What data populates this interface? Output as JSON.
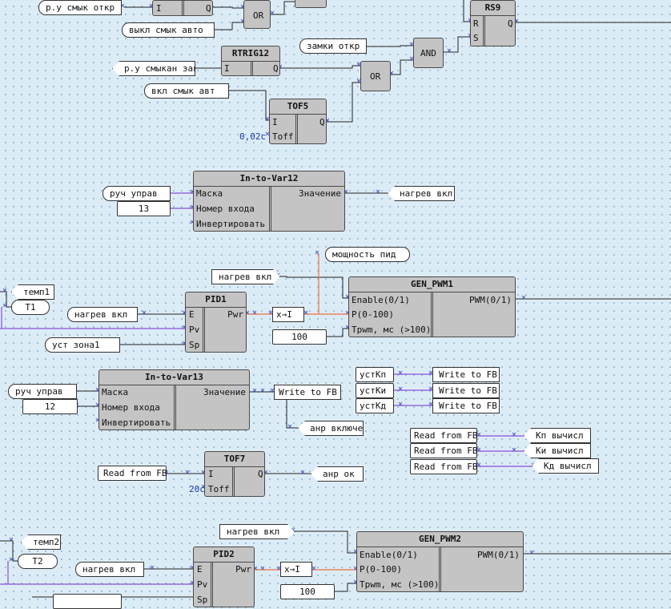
{
  "colors": {
    "wire": "#222222",
    "purple": "#8a4fd8",
    "orange": "#f07040",
    "block": "#c4c4c4"
  },
  "blocks": {
    "rs9": {
      "title": "RS9",
      "pins": [
        "R",
        "S",
        "Q"
      ]
    },
    "or_top": {
      "title": "OR"
    },
    "rtrig12": {
      "title": "RTRIG12",
      "pins": [
        "I",
        "Q"
      ]
    },
    "and": {
      "title": "AND"
    },
    "or_mid": {
      "title": "OR"
    },
    "tof5": {
      "title": "TOF5",
      "pins": [
        "I",
        "Toff",
        "Q"
      ],
      "const": "0,02c"
    },
    "in_to_var12": {
      "title": "In-to-Var12",
      "pins": [
        "Маска",
        "Номер входа",
        "Инвертировать",
        "Значение"
      ]
    },
    "gen_pwm1": {
      "title": "GEN_PWM1",
      "pins": [
        "Enable(0/1)",
        "P(0-100)",
        "Tpwm, мс (>100)",
        "PWM(0/1)"
      ]
    },
    "pid1": {
      "title": "PID1",
      "pins": [
        "E",
        "Pv",
        "Sp",
        "Pwr"
      ]
    },
    "in_to_var13": {
      "title": "In-to-Var13",
      "pins": [
        "Маска",
        "Номер входа",
        "Инвертировать",
        "Значение"
      ]
    },
    "tof7": {
      "title": "TOF7",
      "pins": [
        "I",
        "Toff",
        "Q"
      ],
      "const": "20c"
    },
    "gen_pwm2": {
      "title": "GEN_PWM2",
      "pins": [
        "Enable(0/1)",
        "P(0-100)",
        "Tpwm, мс (>100)",
        "PWM(0/1)"
      ]
    },
    "pid2": {
      "title": "PID2",
      "pins": [
        "E",
        "Pv",
        "Sp",
        "Pwr"
      ]
    },
    "top_i_q": {
      "pins": [
        "I",
        "Q"
      ]
    }
  },
  "labels": {
    "ru_smyk_otkr": "р.у смык откр",
    "vykl_smyk_avto": "выкл смык авто",
    "zamki_otkr": "замки откр",
    "ru_smykan_zakr": "р.у смыкан закр",
    "vkl_smyk_avt": "вкл смык авт",
    "ruch_uprav_1": "руч управ",
    "num_13": "13",
    "nagrev_vkl_out": "нагрев вкл",
    "moshnost_pid": "мощность пид",
    "nagrev_vkl_2": "нагрев вкл",
    "temp1": "темп1",
    "t1": "T1",
    "nagrev_vkl_3": "нагрев вкл",
    "ust_zona1": "уст зона1",
    "xi_1": "x→I",
    "c100_1": "100",
    "ruch_uprav_2": "руч управ",
    "num_12": "12",
    "write_fb_1": "Write to FB",
    "anr_vklyuchen": "анр включен",
    "ust_kp": "устКп",
    "ust_ki": "устКи",
    "ust_kd": "устКд",
    "write_fb_2": "Write to FB",
    "write_fb_3": "Write to FB",
    "write_fb_4": "Write to FB",
    "read_fb_1": "Read from FB",
    "read_fb_2": "Read from FB",
    "read_fb_3": "Read from FB",
    "kp_vychisl": "Кп вычисл",
    "ki_vychisl": "Ки вычисл",
    "kd_vychisl": "Кд вычисл",
    "read_fb_4": "Read from FB",
    "anr_ok": "анр ок",
    "nagrev_vkl_4": "нагрев вкл",
    "temp2": "темп2",
    "t2": "T2",
    "nagrev_vkl_5": "нагрев вкл",
    "xi_2": "x→I",
    "c100_2": "100"
  }
}
